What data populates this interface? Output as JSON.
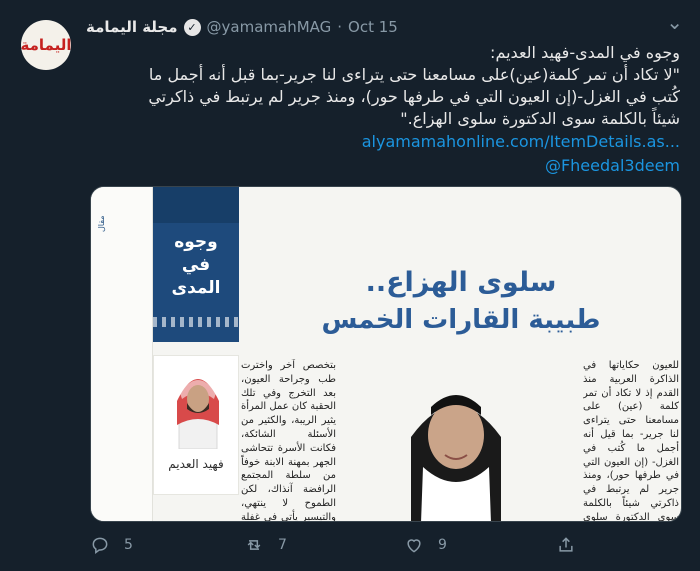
{
  "account": {
    "display_name": "مجلة اليمامة",
    "handle": "@yamamahMAG",
    "separator": "·",
    "date": "Oct 15",
    "avatar_text": "اليمامة"
  },
  "tweet": {
    "lines": [
      "وجوه في المدى-فهيد العديم:",
      "\"لا تكاد أن تمر كلمة(عين)على مسامعنا حتى يتراءى لنا جرير-بما قبل أنه أجمل ما",
      "كُتب في الغزل-(إن العيون التي في طرفها حور)، ومنذ جرير لم يرتبط في ذاكرتي",
      "شيئاً بالكلمة سوى الدكتورة سلوى الهزاع.\""
    ],
    "link_text": "alyamamahonline.com/ItemDetails.as...",
    "mention": "@Fheedal3deem"
  },
  "media": {
    "strip_text": "مقال",
    "section_title_1": "وجوه",
    "section_title_2": "في",
    "section_title_3": "المدى",
    "headline_1": "سلوى الهزاع..",
    "headline_2": "طبيبة القارات الخمس",
    "author_name": "فهيد العديم",
    "col_left": "بتخصص آخر واخترت طب وجراحة العيون، بعد التخرج وفي تلك الحقبة كان عمل المرأة يثير الريبة، والكثير من الأسئلة الشائكة، فكانت الأسرة تتحاشى الجهر بمهنة الابنة خوفاً من سلطة المجتمع الرافضة آنذاك، لكن الطموح لا ينتهي، والتيسير يأتي في غفلة ليحقق لك طموحك، فالقدر يعيد",
    "col_right": "للعيون حكاياتها في الذاكرة العربية منذ القدم إذ لا تكاد أن تمر كلمة (عين) على مسامعنا حتى يتراءى لنا جرير- بما قيل أنه أجمل ما كُتب في الغزل- (إن العيون التي في طرفها حور)، ومنذ جرير لم يرتبط في ذاكرتي شيئاً بالكلمة سوى الدكتورة سلوى الهزاع، وقد تكون المسافة بين النظرة العلمية"
  },
  "actions": {
    "reply_count": "5",
    "retweet_count": "7",
    "like_count": "9"
  },
  "colors": {
    "background": "#15202b",
    "link": "#1b95e0",
    "muted": "#8899a6",
    "magazine_blue": "#1e4a7c"
  }
}
